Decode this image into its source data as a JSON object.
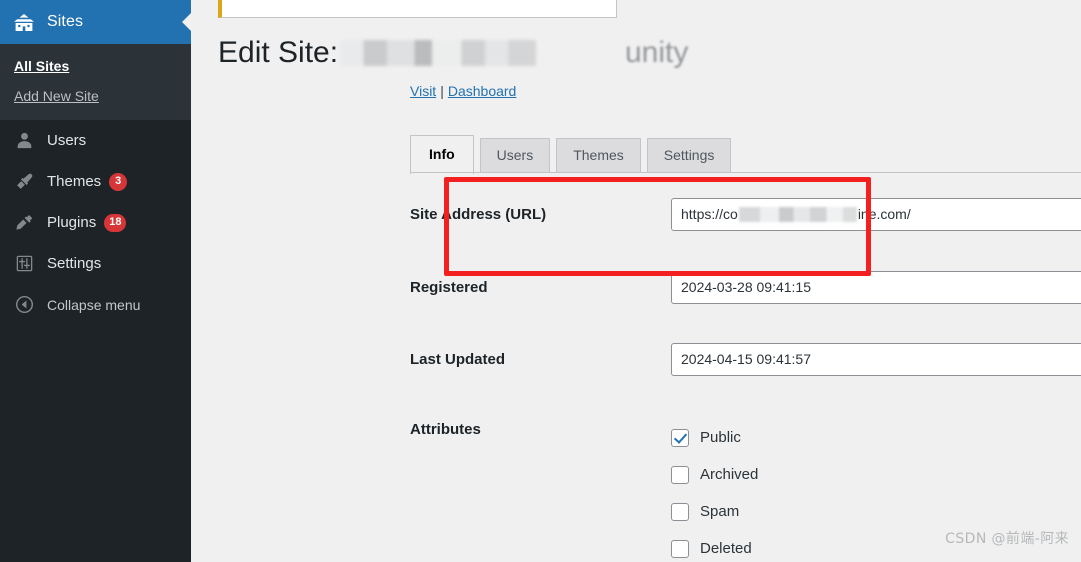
{
  "sidebar": {
    "header": {
      "label": "Sites",
      "icon": "sites-building-icon"
    },
    "submenu": [
      {
        "label": "All Sites",
        "current": true
      },
      {
        "label": "Add New Site",
        "current": false
      }
    ],
    "items": [
      {
        "label": "Users",
        "icon": "user-icon",
        "badge": ""
      },
      {
        "label": "Themes",
        "icon": "brush-icon",
        "badge": "3"
      },
      {
        "label": "Plugins",
        "icon": "plug-icon",
        "badge": "18"
      },
      {
        "label": "Settings",
        "icon": "sliders-icon",
        "badge": ""
      },
      {
        "label": "Collapse menu",
        "icon": "collapse-arrow-icon",
        "badge": ""
      }
    ],
    "colors": {
      "background": "#1d2327",
      "submenu_background": "#2c3338",
      "header_background": "#2271b1",
      "badge": "#d63638"
    }
  },
  "main": {
    "page_title": "Edit Site:",
    "page_title_redacted_tail": "unity",
    "links": {
      "visit": "Visit",
      "separator": "|",
      "dashboard": "Dashboard"
    },
    "tabs": [
      {
        "label": "Info",
        "active": true
      },
      {
        "label": "Users",
        "active": false
      },
      {
        "label": "Themes",
        "active": false
      },
      {
        "label": "Settings",
        "active": false
      }
    ],
    "fields": {
      "site_address": {
        "label": "Site Address (URL)",
        "value_prefix": "https://co",
        "value_suffix": "ine.com/",
        "redacted": true
      },
      "registered": {
        "label": "Registered",
        "value": "2024-03-28 09:41:15"
      },
      "last_updated": {
        "label": "Last Updated",
        "value": "2024-04-15 09:41:57"
      },
      "attributes": {
        "label": "Attributes",
        "options": [
          {
            "label": "Public",
            "checked": true
          },
          {
            "label": "Archived",
            "checked": false
          },
          {
            "label": "Spam",
            "checked": false
          },
          {
            "label": "Deleted",
            "checked": false
          }
        ]
      }
    },
    "annotation": {
      "type": "red-rectangle-highlight",
      "color": "#f42020",
      "targets": "site_address"
    },
    "notice": {
      "accent_color": "#dba617"
    }
  },
  "watermark": {
    "text": "CSDN @前端-阿来"
  }
}
